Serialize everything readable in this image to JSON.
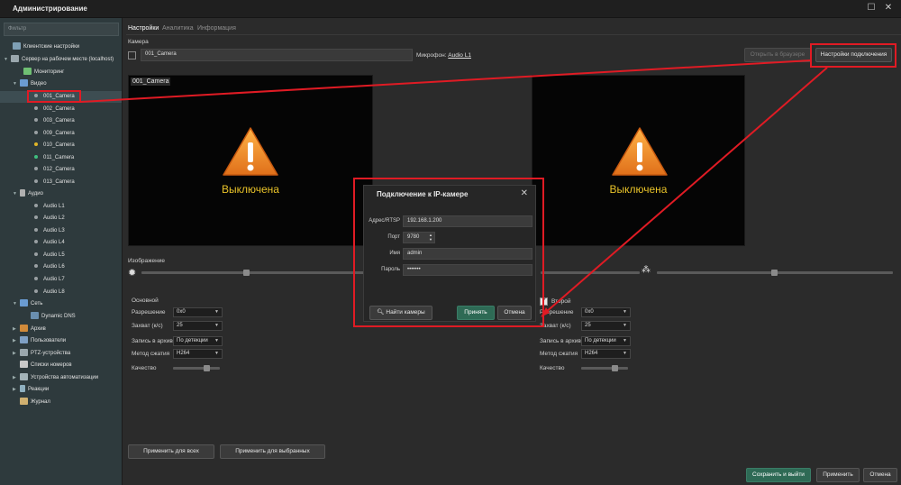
{
  "window": {
    "title": "Администрирование"
  },
  "sidebar": {
    "filter_placeholder": "Фильтр",
    "items": [
      {
        "label": "Клиентские настройки"
      },
      {
        "label": "Сервер на рабочем месте (localhost)"
      },
      {
        "label": "Мониторинг"
      },
      {
        "label": "Видео"
      },
      {
        "label": "001_Camera"
      },
      {
        "label": "002_Camera"
      },
      {
        "label": "003_Camera"
      },
      {
        "label": "009_Camera"
      },
      {
        "label": "010_Camera"
      },
      {
        "label": "011_Camera"
      },
      {
        "label": "012_Camera"
      },
      {
        "label": "013_Camera"
      },
      {
        "label": "Аудио"
      },
      {
        "label": "Audio L1"
      },
      {
        "label": "Audio L2"
      },
      {
        "label": "Audio L3"
      },
      {
        "label": "Audio L4"
      },
      {
        "label": "Audio L5"
      },
      {
        "label": "Audio L6"
      },
      {
        "label": "Audio L7"
      },
      {
        "label": "Audio L8"
      },
      {
        "label": "Сеть"
      },
      {
        "label": "Dynamic DNS"
      },
      {
        "label": "Архив"
      },
      {
        "label": "Пользователи"
      },
      {
        "label": "PTZ-устройства"
      },
      {
        "label": "Списки номеров"
      },
      {
        "label": "Устройства автоматизации"
      },
      {
        "label": "Реакции"
      },
      {
        "label": "Журнал"
      }
    ]
  },
  "tabs": [
    "Настройки",
    "Аналитика",
    "Информация"
  ],
  "camera": {
    "section_label": "Камера",
    "name_value": "001_Camera",
    "microphone_label": "Микрофон:",
    "microphone_link": "Audio L1",
    "open_browser_btn": "Открыть в браузере",
    "connection_settings_btn": "Настройки подключения"
  },
  "preview": {
    "left_title": "001_Camera",
    "off_text_left": "Выключена",
    "off_text_right": "Выключена"
  },
  "image": {
    "label": "Изображение"
  },
  "primary": {
    "title": "Основной",
    "resolution_label": "Разрешение",
    "resolution_value": "0x0",
    "capture_label": "Захват (к/с)",
    "capture_value": "25",
    "archive_label": "Запись в архив",
    "archive_value": "По детекции",
    "codec_label": "Метод сжатия",
    "codec_value": "H264",
    "quality_label": "Качество"
  },
  "secondary": {
    "title": "Второй",
    "resolution_label": "Разрешение",
    "resolution_value": "0x0",
    "capture_label": "Захват (к/с)",
    "capture_value": "25",
    "archive_label": "Запись в архив",
    "archive_value": "По детекции",
    "codec_label": "Метод сжатия",
    "codec_value": "H264",
    "quality_label": "Качество"
  },
  "apply_all_btn": "Применить для всех",
  "apply_selected_btn": "Применить для выбранных",
  "footer": {
    "save_exit": "Сохранить и выйти",
    "apply": "Применить",
    "cancel": "Отмена"
  },
  "dialog": {
    "title": "Подключение к IP-камере",
    "address_label": "Адрес/RTSP",
    "address_value": "192.168.1.200",
    "port_label": "Порт",
    "port_value": "9780",
    "name_label": "Имя",
    "name_value": "admin",
    "password_label": "Пароль",
    "password_value": "•••••••",
    "find_btn": "Найти камеры",
    "accept_btn": "Принять",
    "cancel_btn": "Отмена"
  },
  "colors": {
    "accent_red": "#e01b24",
    "warning_orange": "#f7931e",
    "off_yellow": "#e8c229",
    "sidebar_bg": "#2e3a3d",
    "button_green": "#2e6a55"
  }
}
